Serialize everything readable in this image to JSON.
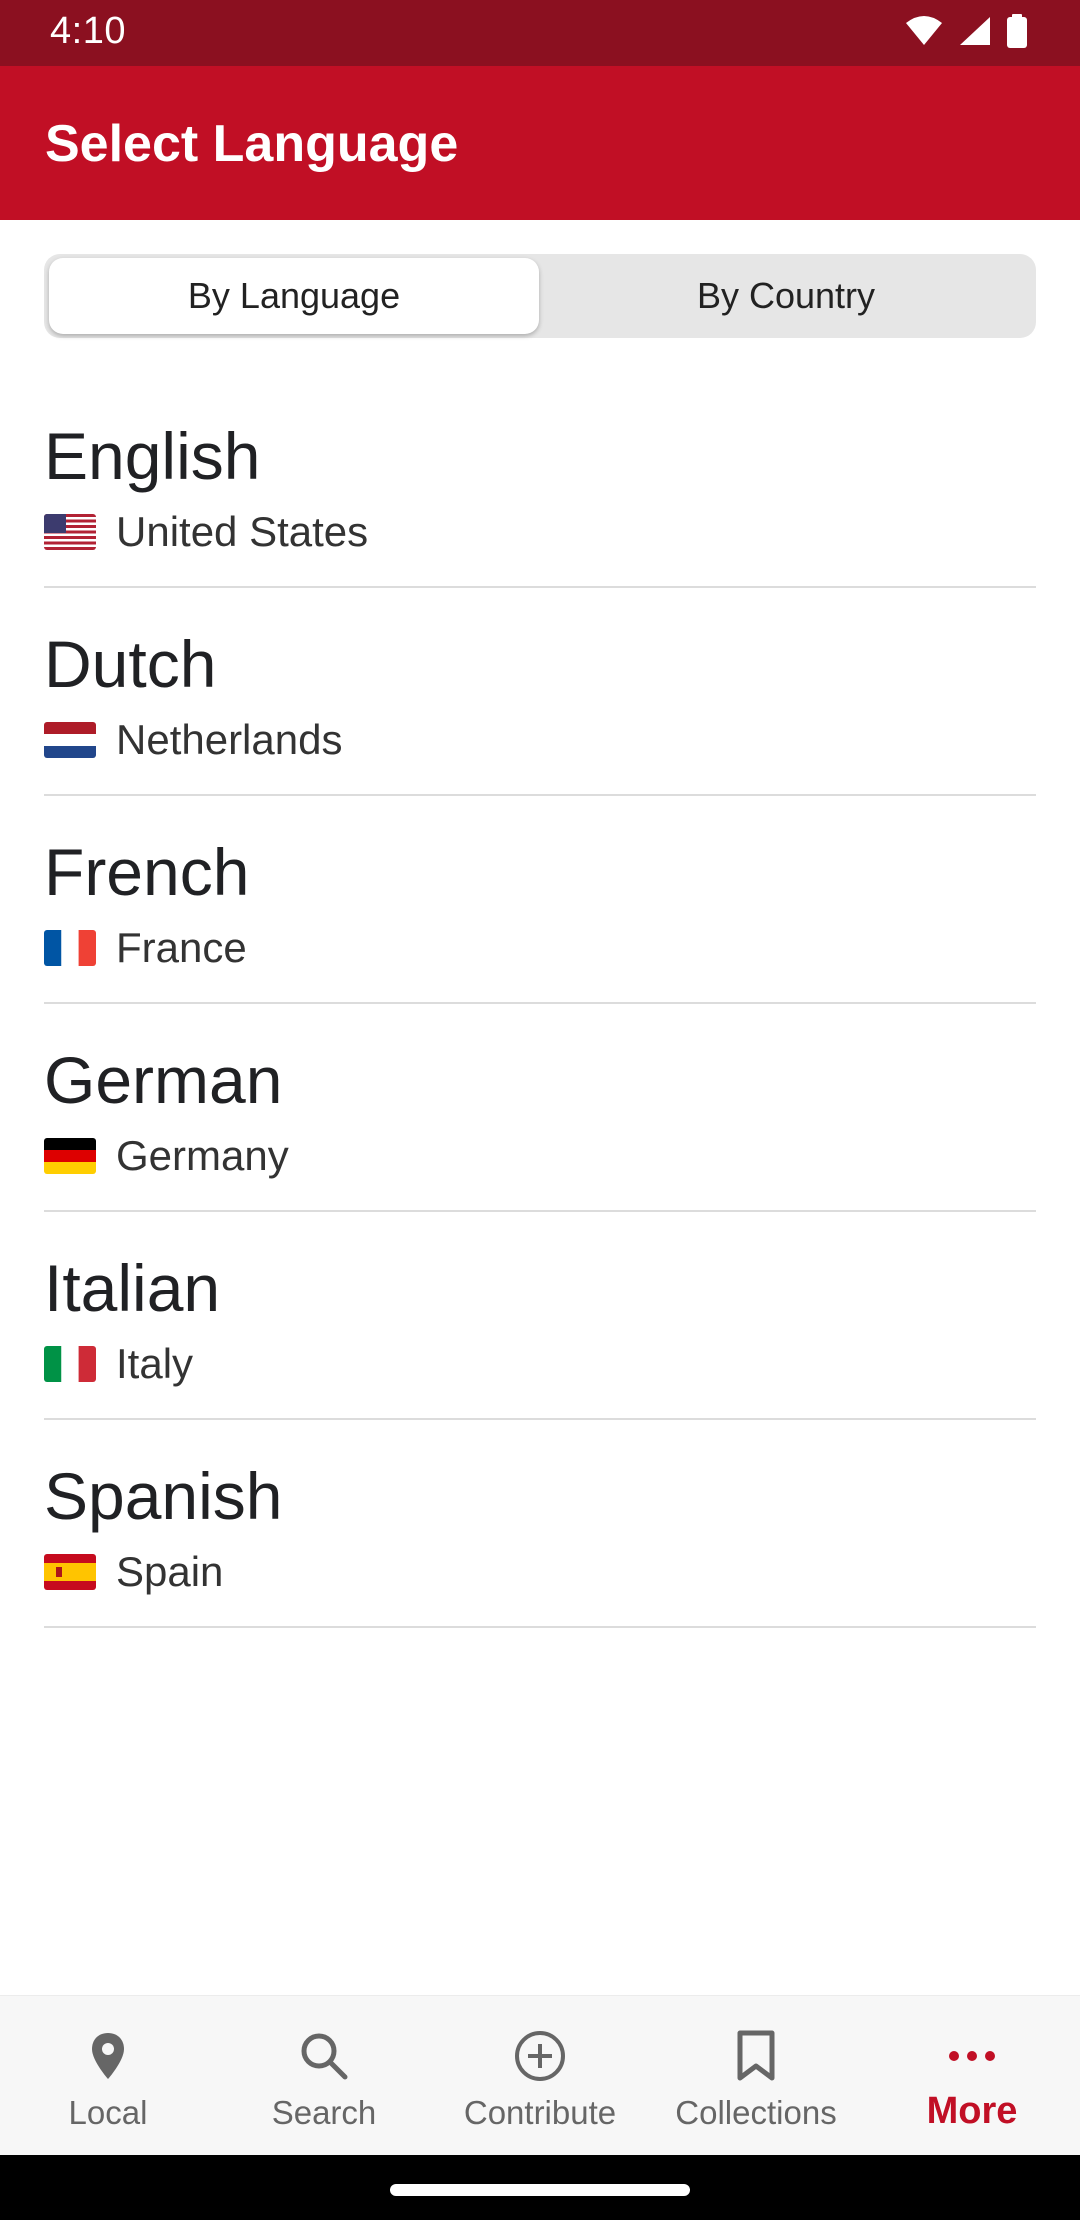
{
  "status_bar": {
    "time": "4:10"
  },
  "app_bar": {
    "title": "Select Language"
  },
  "tabs": [
    {
      "label": "By Language",
      "selected": true
    },
    {
      "label": "By Country",
      "selected": false
    }
  ],
  "languages": [
    {
      "name": "English",
      "country": "United States",
      "flag": "us-flag"
    },
    {
      "name": "Dutch",
      "country": "Netherlands",
      "flag": "nl-flag"
    },
    {
      "name": "French",
      "country": "France",
      "flag": "fr-flag"
    },
    {
      "name": "German",
      "country": "Germany",
      "flag": "de-flag"
    },
    {
      "name": "Italian",
      "country": "Italy",
      "flag": "it-flag"
    },
    {
      "name": "Spanish",
      "country": "Spain",
      "flag": "es-flag"
    }
  ],
  "bottom_nav": [
    {
      "label": "Local",
      "icon": "location-pin-icon"
    },
    {
      "label": "Search",
      "icon": "search-icon"
    },
    {
      "label": "Contribute",
      "icon": "add-circle-icon"
    },
    {
      "label": "Collections",
      "icon": "bookmark-icon"
    },
    {
      "label": "More",
      "icon": "more-dots-icon",
      "active": true
    }
  ],
  "colors": {
    "brand": "#c10f25",
    "status_bar": "#8b1020"
  }
}
